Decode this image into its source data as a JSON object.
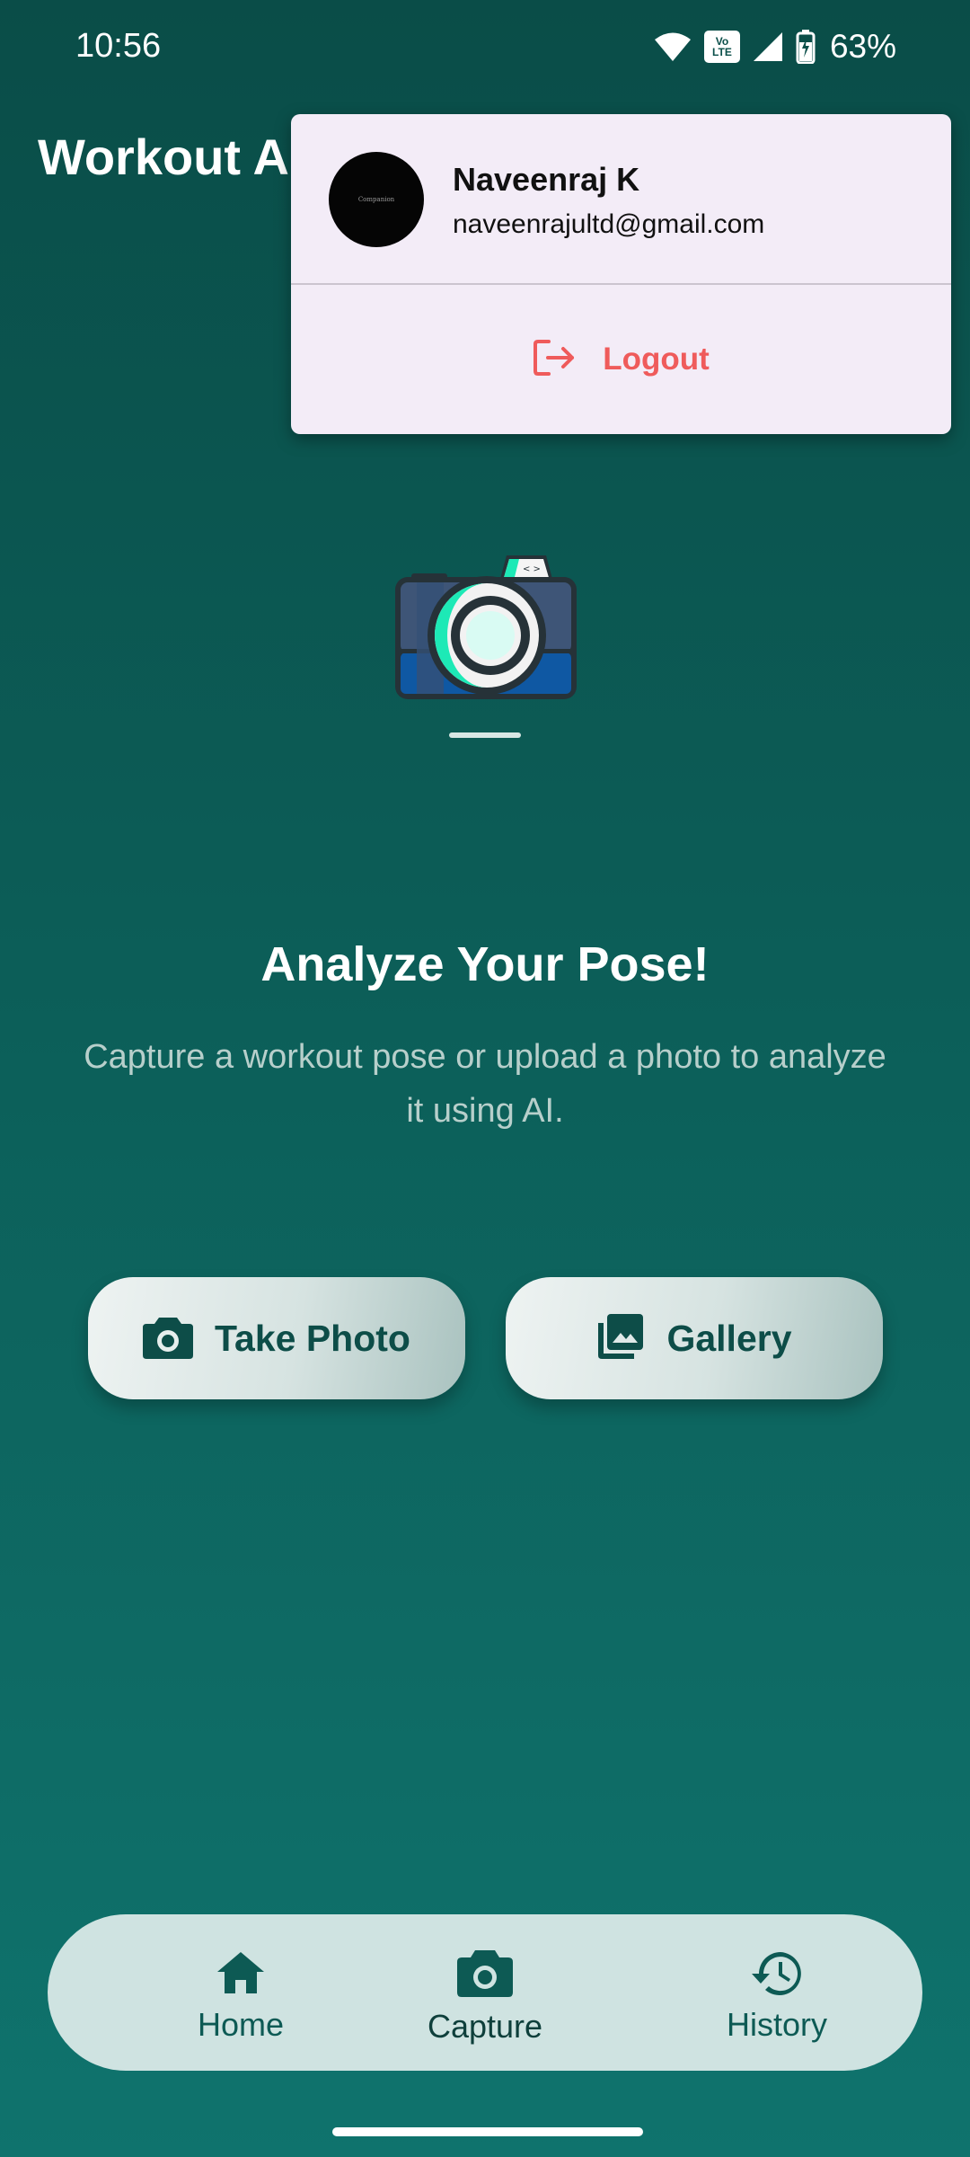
{
  "status_bar": {
    "time": "10:56",
    "network_badge": "Vo LTE",
    "battery_percent": "63%"
  },
  "app_bar": {
    "title": "Workout Analyzer"
  },
  "account_menu": {
    "avatar_text": "Companion",
    "user_name": "Naveenraj K",
    "user_email": "naveenrajultd@gmail.com",
    "logout_label": "Logout"
  },
  "main": {
    "headline": "Analyze Your Pose!",
    "description": "Capture a workout pose or upload a photo to analyze it using AI.",
    "take_photo_label": "Take Photo",
    "gallery_label": "Gallery"
  },
  "bottom_nav": {
    "items": [
      {
        "label": "Home",
        "icon": "home-icon"
      },
      {
        "label": "Capture",
        "icon": "camera-icon"
      },
      {
        "label": "History",
        "icon": "history-icon"
      }
    ],
    "active": "Capture"
  },
  "colors": {
    "background_top": "#0a4d48",
    "background_bottom": "#0f736d",
    "popup_bg": "#f3ecf7",
    "logout": "#ef5b5b",
    "button_text": "#0d4d48",
    "nav_bg": "#cfe3e1"
  }
}
